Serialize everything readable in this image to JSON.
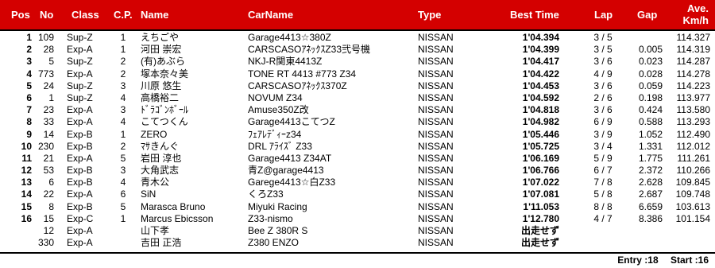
{
  "header": {
    "pos": "Pos",
    "no": "No",
    "class": "Class",
    "cp": "C.P.",
    "name": "Name",
    "carname": "CarName",
    "type": "Type",
    "best_time": "Best Time",
    "lap": "Lap",
    "gap": "Gap",
    "ave_line1": "Ave.",
    "ave_line2": "Km/h"
  },
  "rows": [
    {
      "pos": "1",
      "no": "109",
      "class": "Sup-Z",
      "cp": "1",
      "name": "えちごや",
      "car": "Garage4413☆380Z",
      "type": "NISSAN",
      "best": "1'04.394",
      "lap": "3 / 5",
      "gap": "",
      "ave": "114.327"
    },
    {
      "pos": "2",
      "no": "28",
      "class": "Exp-A",
      "cp": "1",
      "name": "河田 崇宏",
      "car": "CARSCASOｱﾈｯｸｽZ33弐号機",
      "type": "NISSAN",
      "best": "1'04.399",
      "lap": "3 / 5",
      "gap": "0.005",
      "ave": "114.319"
    },
    {
      "pos": "3",
      "no": "5",
      "class": "Sup-Z",
      "cp": "2",
      "name": "(有)あぶら",
      "car": "NKJ-R関東4413Z",
      "type": "NISSAN",
      "best": "1'04.417",
      "lap": "3 / 6",
      "gap": "0.023",
      "ave": "114.287"
    },
    {
      "pos": "4",
      "no": "773",
      "class": "Exp-A",
      "cp": "2",
      "name": "塚本奈々美",
      "car": "TONE RT 4413 #773 Z34",
      "type": "NISSAN",
      "best": "1'04.422",
      "lap": "4 / 9",
      "gap": "0.028",
      "ave": "114.278"
    },
    {
      "pos": "5",
      "no": "24",
      "class": "Sup-Z",
      "cp": "3",
      "name": "川原 悠生",
      "car": "CARSCASOｱﾈｯｸｽ370Z",
      "type": "NISSAN",
      "best": "1'04.453",
      "lap": "3 / 6",
      "gap": "0.059",
      "ave": "114.223"
    },
    {
      "pos": "6",
      "no": "1",
      "class": "Sup-Z",
      "cp": "4",
      "name": "高橋裕二",
      "car": "NOVUM Z34",
      "type": "NISSAN",
      "best": "1'04.592",
      "lap": "2 / 6",
      "gap": "0.198",
      "ave": "113.977"
    },
    {
      "pos": "7",
      "no": "23",
      "class": "Exp-A",
      "cp": "3",
      "name": "ﾄﾞﾗｺﾞﾝﾎﾞｰﾙ",
      "car": "Amuse350Z改",
      "type": "NISSAN",
      "best": "1'04.818",
      "lap": "3 / 6",
      "gap": "0.424",
      "ave": "113.580"
    },
    {
      "pos": "8",
      "no": "33",
      "class": "Exp-A",
      "cp": "4",
      "name": "こてつくん",
      "car": "Garage4413こてつZ",
      "type": "NISSAN",
      "best": "1'04.982",
      "lap": "6 / 9",
      "gap": "0.588",
      "ave": "113.293"
    },
    {
      "pos": "9",
      "no": "14",
      "class": "Exp-B",
      "cp": "1",
      "name": "ZERO",
      "car": "ﾌｪｱﾚﾃﾞｨｰz34",
      "type": "NISSAN",
      "best": "1'05.446",
      "lap": "3 / 9",
      "gap": "1.052",
      "ave": "112.490"
    },
    {
      "pos": "10",
      "no": "230",
      "class": "Exp-B",
      "cp": "2",
      "name": "ﾏｻきんぐ",
      "car": "DRL ｱﾗｲｽﾞ Z33",
      "type": "NISSAN",
      "best": "1'05.725",
      "lap": "3 / 4",
      "gap": "1.331",
      "ave": "112.012"
    },
    {
      "pos": "11",
      "no": "21",
      "class": "Exp-A",
      "cp": "5",
      "name": "岩田 淳也",
      "car": "Garage4413 Z34AT",
      "type": "NISSAN",
      "best": "1'06.169",
      "lap": "5 / 9",
      "gap": "1.775",
      "ave": "111.261"
    },
    {
      "pos": "12",
      "no": "53",
      "class": "Exp-B",
      "cp": "3",
      "name": "大角武志",
      "car": "青Z@garage4413",
      "type": "NISSAN",
      "best": "1'06.766",
      "lap": "6 / 7",
      "gap": "2.372",
      "ave": "110.266"
    },
    {
      "pos": "13",
      "no": "6",
      "class": "Exp-B",
      "cp": "4",
      "name": "青木公",
      "car": "Garege4413☆白Z33",
      "type": "NISSAN",
      "best": "1'07.022",
      "lap": "7 / 8",
      "gap": "2.628",
      "ave": "109.845"
    },
    {
      "pos": "14",
      "no": "22",
      "class": "Exp-A",
      "cp": "6",
      "name": "SiN",
      "car": "くろZ33",
      "type": "NISSAN",
      "best": "1'07.081",
      "lap": "5 / 8",
      "gap": "2.687",
      "ave": "109.748"
    },
    {
      "pos": "15",
      "no": "8",
      "class": "Exp-B",
      "cp": "5",
      "name": "Marasca Bruno",
      "car": "Miyuki Racing",
      "type": "NISSAN",
      "best": "1'11.053",
      "lap": "8 / 8",
      "gap": "6.659",
      "ave": "103.613"
    },
    {
      "pos": "16",
      "no": "15",
      "class": "Exp-C",
      "cp": "1",
      "name": "Marcus Ebicsson",
      "car": "Z33-nismo",
      "type": "NISSAN",
      "best": "1'12.780",
      "lap": "4 / 7",
      "gap": "8.386",
      "ave": "101.154"
    },
    {
      "pos": "",
      "no": "12",
      "class": "Exp-A",
      "cp": "",
      "name": "山下孝",
      "car": "Bee Z 380R S",
      "type": "NISSAN",
      "best": "出走せず",
      "lap": "",
      "gap": "",
      "ave": ""
    },
    {
      "pos": "",
      "no": "330",
      "class": "Exp-A",
      "cp": "",
      "name": "吉田 正浩",
      "car": "Z380 ENZO",
      "type": "NISSAN",
      "best": "出走せず",
      "lap": "",
      "gap": "",
      "ave": ""
    }
  ],
  "footer": {
    "entry": "Entry :18",
    "start": "Start :16"
  },
  "colors": {
    "header_bg": "#d40000",
    "header_text": "#ffffff"
  }
}
